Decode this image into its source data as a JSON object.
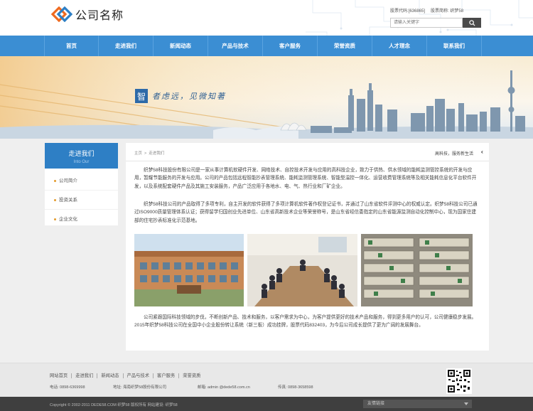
{
  "header": {
    "logo_text": "公司名称",
    "stock_code": "股票代码:[636865]",
    "stock_name": "股票简称: 织梦58",
    "search_placeholder": "请输入关键字"
  },
  "nav": [
    "首页",
    "走进我们",
    "新闻动态",
    "产品与技术",
    "客户服务",
    "荣誉资质",
    "人才理念",
    "联系我们"
  ],
  "banner": {
    "slogan_char": "智",
    "slogan_text": "者虑远，见微知著"
  },
  "sidebar": {
    "title": "走进我们",
    "subtitle": "Into Our",
    "items": [
      "公司简介",
      "投资关系",
      "企业文化"
    ]
  },
  "breadcrumb": {
    "home": "主页",
    "sep": ">",
    "current": "走进我们",
    "tagline": "高科技，服务新生活"
  },
  "content": {
    "para1": "织梦58科技股份有限公司是一家从事计算机软硬件开发、网络技术、自控技术开发与应用的高科技企业，致力于供热、供水领域的能耗监测管控系统的开发与应用，暂耀节能服务的开发与应用。公司的产品包括远程智能抄表管理系统、能耗监测管理系统、智能型温控一体化、运营收费管理系统等及相关能耗信息化平台软件开发，以及系统配套硬件产品及其施工安装服务，产品广泛应用于各地水、电、气、热行业和厂矿企业。",
    "para2": "织梦58科技公司的产品取得了多项专利，自主开发的软件获得了多项计算机软件著作权登记证书，并通过了山东省软件评测中心的权威认定。织梦58科技公司已通过ISO9000质量管理体系认证；获得留学归国创业先进单位、山东省高新技术企业等荣誉称号，是山东省经信委指定的山东省能源监测自动化控制中心，现为国家住建部的住宅抄表标准化示范基地。",
    "para3": "公司紧跟国际科技领域的步伐，不断创新产品、技术和服务，以客户需求为中心，为客户提供更好的技术产品和服务，得到更多用户的认可，公司健康稳步发展。2015年织梦58科技公司在全国中小企业股份转让系统（新三板）成功挂牌，股票代码832403，为今后公司成长提供了更为广阔的发展舞台。"
  },
  "footer": {
    "links": [
      "网站首页",
      "走进我们",
      "新闻动态",
      "产品与技术",
      "客户服务",
      "荣誉资质"
    ],
    "phone": "电话: 0898-6369998",
    "address": "地址: 海南织梦58股份有限公司",
    "email": "邮箱: admin @dede58.com.cn",
    "fax": "传真: 0898-3658598",
    "copyright": "Copyright © 2002-2011 DEDE58.COM 织梦58 版权所有 网站建设: 织梦58",
    "friend_links": "友情链接"
  }
}
